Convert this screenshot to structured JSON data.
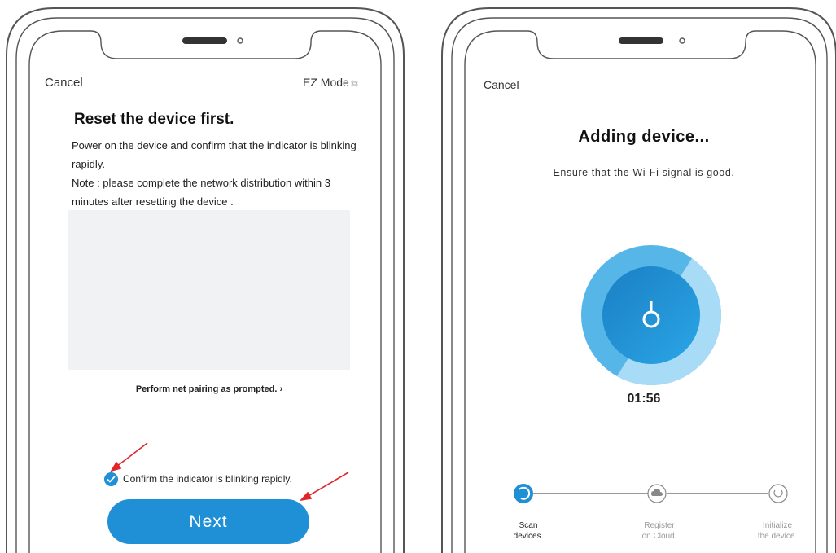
{
  "left": {
    "cancel": "Cancel",
    "mode": "EZ Mode",
    "title": "Reset the device first.",
    "desc1": "Power on the device and confirm that the indicator is blinking rapidly.",
    "desc2": "Note : please complete the network distribution within 3 minutes after resetting the device .",
    "link": "Perform net pairing as prompted.",
    "confirm": "Confirm the indicator is blinking rapidly.",
    "next": "Next"
  },
  "right": {
    "cancel": "Cancel",
    "title": "Adding device...",
    "subtitle": "Ensure that the Wi-Fi signal is good.",
    "timer": "01:56",
    "steps": [
      {
        "line1": "Scan",
        "line2": "devices."
      },
      {
        "line1": "Register",
        "line2": "on Cloud."
      },
      {
        "line1": "Initialize",
        "line2": "the device."
      }
    ]
  },
  "colors": {
    "accent": "#1f8fd6",
    "annotation_arrow": "#e0262b",
    "indicator_led": "#f2d21b",
    "ring_light": "#8fd0f3",
    "circle_core": "#1a8fd2"
  },
  "icons": {
    "power": "power-icon",
    "check": "check-icon",
    "cloud": "cloud-icon",
    "scan": "scan-spinner-icon",
    "init": "init-icon"
  }
}
